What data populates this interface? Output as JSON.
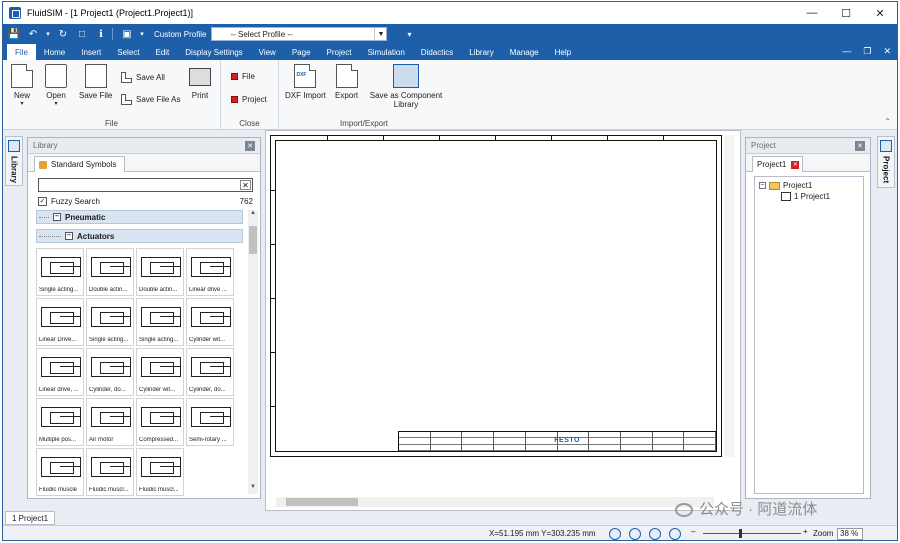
{
  "window": {
    "title": "FluidSIM - [1  Project1 (Project1.Project1)]"
  },
  "qat": {
    "profile_label": "Custom Profile",
    "profile_value": "-- Select Profile --"
  },
  "menu": [
    "File",
    "Home",
    "Insert",
    "Select",
    "Edit",
    "Display Settings",
    "View",
    "Page",
    "Project",
    "Simulation",
    "Didactics",
    "Library",
    "Manage",
    "Help"
  ],
  "ribbon": {
    "file_group": {
      "label": "File",
      "new": "New",
      "open": "Open",
      "save_file": "Save File",
      "save_all": "Save All",
      "save_file_as": "Save File As",
      "print": "Print"
    },
    "close_group": {
      "label": "Close",
      "file": "File",
      "project": "Project"
    },
    "import_export_group": {
      "label": "Import/Export",
      "dxf_import": "DXF Import",
      "export": "Export",
      "save_as_component_library": "Save as Component Library",
      "dxf_badge": "DXF"
    }
  },
  "side_tabs": {
    "library": "Library",
    "project": "Project"
  },
  "library": {
    "title": "Library",
    "tab": "Standard Symbols",
    "search_value": "",
    "fuzzy_search": "Fuzzy Search",
    "fuzzy_checked": "✓",
    "count": "762",
    "tree": [
      {
        "label": "Pneumatic"
      },
      {
        "label": "Actuators"
      }
    ],
    "symbols": [
      "Single acting...",
      "Double actin...",
      "Double actin...",
      "Linear drive ...",
      "Linear Drive...",
      "Single acting...",
      "Single acting...",
      "Cylinder wit...",
      "Linear drive, ...",
      "Cylinder, do...",
      "Cylinder wit...",
      "Cylinder, do...",
      "Multiple pos...",
      "Air motor",
      "Compressed...",
      "Semi-rotary ...",
      "Fluidic muscle",
      "Fluidic muscl...",
      "Fluidic muscl..."
    ]
  },
  "canvas": {
    "logo": "FESTO"
  },
  "project": {
    "title": "Project",
    "tab": "Project1",
    "tree": [
      {
        "label": "Project1"
      },
      {
        "label": "1  Project1"
      }
    ]
  },
  "doc_tab": "1  Project1",
  "status": {
    "coords": "X=51.195 mm  Y=303.235 mm",
    "zoom_label": "Zoom",
    "zoom_value": "38 %"
  },
  "watermark": "公众号 · 阿道流体"
}
